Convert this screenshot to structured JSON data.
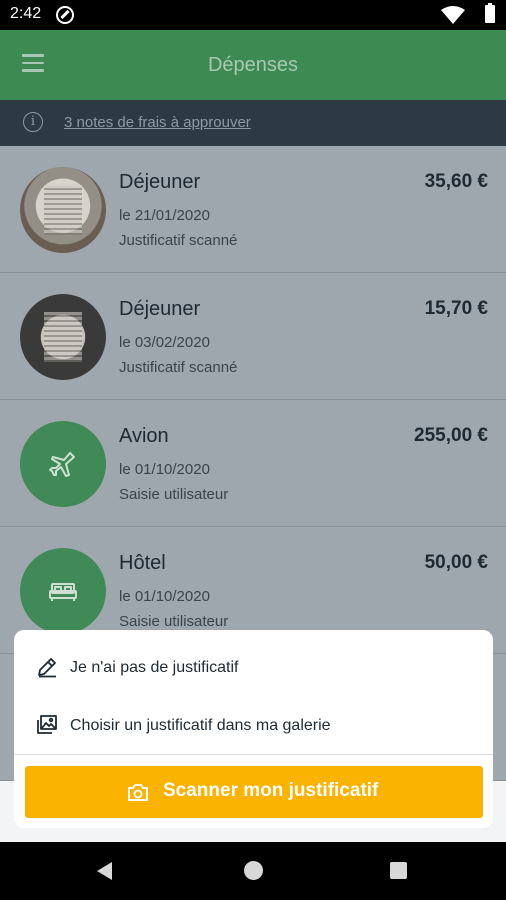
{
  "status_bar": {
    "time": "2:42",
    "icons": [
      "do-not-disturb-icon",
      "wifi-icon",
      "battery-icon"
    ]
  },
  "app_bar": {
    "title": "Dépenses",
    "menu_icon": "hamburger-menu-icon"
  },
  "info_banner": {
    "icon": "info-icon",
    "glyph": "i",
    "link_text": "3 notes de frais à approuver"
  },
  "expenses": [
    {
      "label": "Déjeuner",
      "amount": "35,60 €",
      "date": "le 21/01/2020",
      "source": "Justificatif scanné",
      "thumbnail": "receipt-photo"
    },
    {
      "label": "Déjeuner",
      "amount": "15,70 €",
      "date": "le 03/02/2020",
      "source": "Justificatif scanné",
      "thumbnail": "receipt-photo"
    },
    {
      "label": "Avion",
      "amount": "255,00 €",
      "date": "le 01/10/2020",
      "source": "Saisie utilisateur",
      "thumbnail": "airplane-icon"
    },
    {
      "label": "Hôtel",
      "amount": "50,00 €",
      "date": "le 01/10/2020",
      "source": "Saisie utilisateur",
      "thumbnail": "bed-icon"
    }
  ],
  "bottom_sheet": {
    "no_receipt": {
      "label": "Je n'ai pas de justificatif",
      "icon": "pencil-icon"
    },
    "gallery": {
      "label": "Choisir un justificatif dans ma galerie",
      "icon": "gallery-icon"
    },
    "scan": {
      "label": "Scanner mon justificatif",
      "icon": "camera-icon"
    }
  },
  "colors": {
    "primary": "#3d8a52",
    "banner": "#2d3a44",
    "accent": "#f9b300"
  },
  "nav_bar": {
    "icons": [
      "back-icon",
      "home-icon",
      "recents-icon"
    ]
  }
}
